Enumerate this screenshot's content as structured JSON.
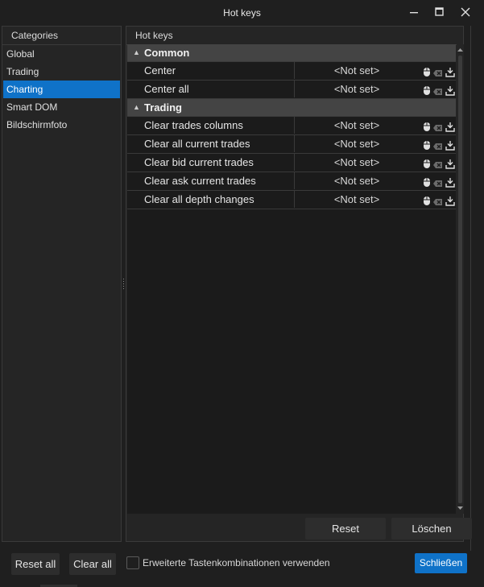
{
  "window": {
    "title": "Hot keys"
  },
  "categories": {
    "header": "Categories",
    "items": [
      {
        "label": "Global",
        "selected": false
      },
      {
        "label": "Trading",
        "selected": false
      },
      {
        "label": "Charting",
        "selected": true
      },
      {
        "label": "Smart DOM",
        "selected": false
      },
      {
        "label": "Bildschirmfoto",
        "selected": false
      }
    ]
  },
  "hotkeys": {
    "header": "Hot keys",
    "groups": [
      {
        "name": "Common",
        "rows": [
          {
            "name": "Center",
            "key": "<Not set>"
          },
          {
            "name": "Center all",
            "key": "<Not set>"
          }
        ]
      },
      {
        "name": "Trading",
        "rows": [
          {
            "name": "Clear trades columns",
            "key": "<Not set>"
          },
          {
            "name": "Clear all current trades",
            "key": "<Not set>"
          },
          {
            "name": "Clear bid current trades",
            "key": "<Not set>"
          },
          {
            "name": "Clear ask current trades",
            "key": "<Not set>"
          },
          {
            "name": "Clear all depth changes",
            "key": "<Not set>"
          }
        ]
      }
    ],
    "row_icons": [
      "mouse-icon",
      "clear-key-icon",
      "reset-default-icon"
    ]
  },
  "panel_buttons": {
    "reset": "Reset",
    "delete": "Löschen"
  },
  "footer": {
    "reset_all": "Reset all",
    "clear_all": "Clear all",
    "extended_checkbox_label": "Erweiterte Tastenkombinationen verwenden",
    "extended_checked": false,
    "close": "Schließen"
  },
  "colors": {
    "accent": "#0f72c8",
    "background": "#1f1f1f",
    "group_header": "#444444"
  }
}
